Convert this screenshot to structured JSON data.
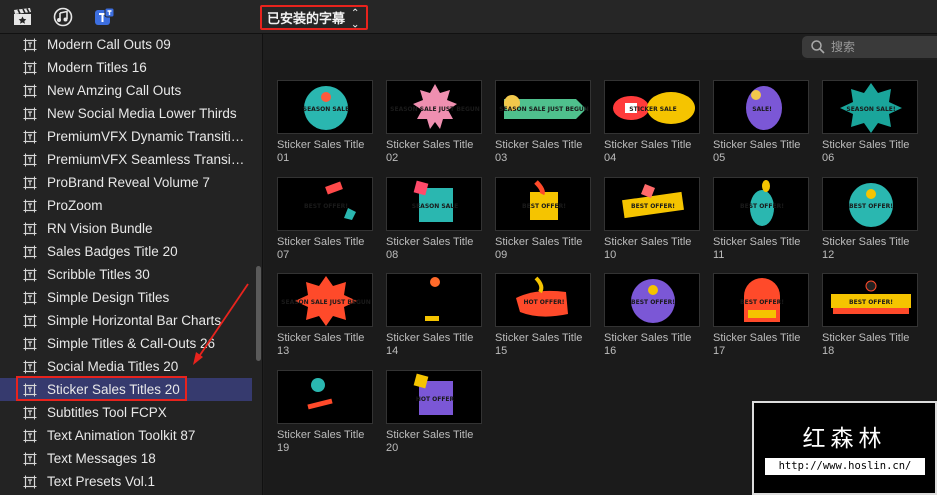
{
  "toolbar": {
    "icons": [
      "clapper-icon",
      "music-notes-icon",
      "titles-icon"
    ],
    "dropdown_label": "已安装的字幕"
  },
  "search": {
    "placeholder": "搜索"
  },
  "sidebar": {
    "items": [
      {
        "label": "Modern Call Outs 09"
      },
      {
        "label": "Modern Titles 16"
      },
      {
        "label": "New Amzing Call Outs"
      },
      {
        "label": "New Social Media Lower Thirds"
      },
      {
        "label": "PremiumVFX Dynamic Transitions"
      },
      {
        "label": "PremiumVFX Seamless Transitions"
      },
      {
        "label": "ProBrand Reveal Volume 7"
      },
      {
        "label": "ProZoom"
      },
      {
        "label": "RN Vision Bundle"
      },
      {
        "label": "Sales Badges Title 20"
      },
      {
        "label": "Scribble Titles 30"
      },
      {
        "label": "Simple Design Titles"
      },
      {
        "label": "Simple Horizontal Bar Charts"
      },
      {
        "label": "Simple Titles & Call-Outs 26"
      },
      {
        "label": "Social Media Titles 20"
      },
      {
        "label": "Sticker Sales Titles 20",
        "selected": true
      },
      {
        "label": "Subtitles Tool FCPX"
      },
      {
        "label": "Text Animation Toolkit 87"
      },
      {
        "label": "Text Messages 18"
      },
      {
        "label": "Text Presets Vol.1"
      }
    ]
  },
  "thumbs": [
    {
      "line1": "Sticker Sales Title",
      "line2": "01",
      "t": "SEASON SALE"
    },
    {
      "line1": "Sticker Sales Title",
      "line2": "02",
      "t": "SEASON SALE JUST BEGUN"
    },
    {
      "line1": "Sticker Sales Title",
      "line2": "03",
      "t": "SEASON SALE JUST BEGUN"
    },
    {
      "line1": "Sticker Sales Title",
      "line2": "04",
      "t": "STICKER SALE"
    },
    {
      "line1": "Sticker Sales Title",
      "line2": "05",
      "t": "SALE!"
    },
    {
      "line1": "Sticker Sales Title",
      "line2": "06",
      "t": "SEASON SALE!"
    },
    {
      "line1": "Sticker Sales Title",
      "line2": "07",
      "t": "BEST OFFER!"
    },
    {
      "line1": "Sticker Sales Title",
      "line2": "08",
      "t": "SEASON SALE"
    },
    {
      "line1": "Sticker Sales Title",
      "line2": "09",
      "t": "BEST OFFER!"
    },
    {
      "line1": "Sticker Sales Title",
      "line2": "10",
      "t": "BEST OFFER!"
    },
    {
      "line1": "Sticker Sales Title",
      "line2": "11",
      "t": "BEST OFFER!"
    },
    {
      "line1": "Sticker Sales Title",
      "line2": "12",
      "t": "BEST OFFER!"
    },
    {
      "line1": "Sticker Sales Title",
      "line2": "13",
      "t": "SEASON SALE JUST BEGUN"
    },
    {
      "line1": "Sticker Sales Title",
      "line2": "14",
      "t": ""
    },
    {
      "line1": "Sticker Sales Title",
      "line2": "15",
      "t": "HOT OFFER!"
    },
    {
      "line1": "Sticker Sales Title",
      "line2": "16",
      "t": "BEST OFFER!"
    },
    {
      "line1": "Sticker Sales Title",
      "line2": "17",
      "t": "BEST OFFER!"
    },
    {
      "line1": "Sticker Sales Title",
      "line2": "18",
      "t": "BEST OFFER!"
    },
    {
      "line1": "Sticker Sales Title",
      "line2": "19",
      "t": ""
    },
    {
      "line1": "Sticker Sales Title",
      "line2": "20",
      "t": "HOT OFFER"
    }
  ],
  "watermark": {
    "title": "红森林",
    "url": "http://www.hoslin.cn/"
  },
  "colors": {
    "selection": "#363a6e",
    "highlight": "#e8231d",
    "panel": "#232323"
  }
}
